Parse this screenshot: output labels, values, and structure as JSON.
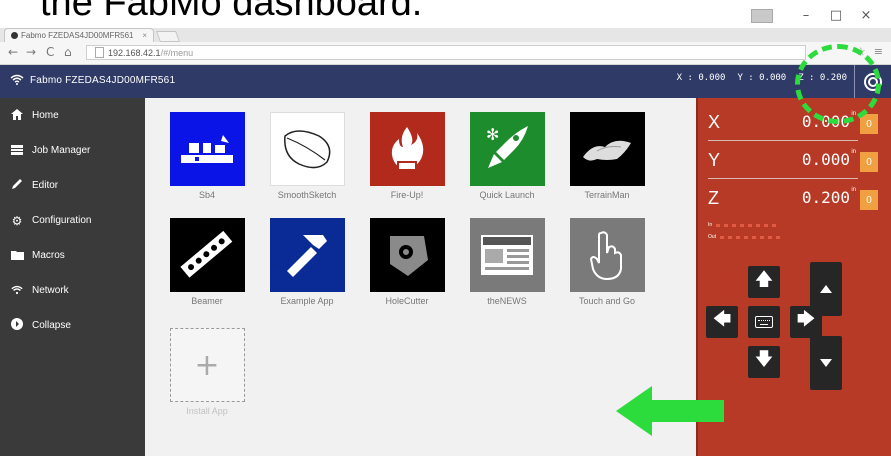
{
  "caption": "the FabMo dashboard.",
  "window": {
    "minimize": "–",
    "maximize": "□",
    "close": "×"
  },
  "browser": {
    "tab_title": "Fabmo FZEDAS4JD00MFR561",
    "tab_close": "×",
    "nav_back": "←",
    "nav_forward": "→",
    "nav_reload": "C",
    "nav_home": "⌂",
    "url_host": "192.168.42.1",
    "url_path": "/#/menu",
    "star": "☆",
    "menu": "≡"
  },
  "topbar": {
    "title": "Fabmo FZEDAS4JD00MFR561",
    "x_readout": "X : 0.000",
    "y_readout": "Y : 0.000",
    "z_readout": "Z : 0.200"
  },
  "sidebar": {
    "items": [
      {
        "label": "Home",
        "icon": "home-icon"
      },
      {
        "label": "Job Manager",
        "icon": "list-icon"
      },
      {
        "label": "Editor",
        "icon": "pencil-icon"
      },
      {
        "label": "Configuration",
        "icon": "gear-icon"
      },
      {
        "label": "Macros",
        "icon": "folder-icon"
      },
      {
        "label": "Network",
        "icon": "wifi-icon"
      },
      {
        "label": "Collapse",
        "icon": "arrow-circle-icon"
      }
    ]
  },
  "apps": [
    {
      "label": "Sb4",
      "color": "#0a14e6"
    },
    {
      "label": "SmoothSketch",
      "color": "#ffffff"
    },
    {
      "label": "Fire-Up!",
      "color": "#b22a1c"
    },
    {
      "label": "Quick Launch",
      "color": "#1c8c2c"
    },
    {
      "label": "TerrainMan",
      "color": "#000000"
    },
    {
      "label": "Beamer",
      "color": "#000000"
    },
    {
      "label": "Example App",
      "color": "#0a2a96"
    },
    {
      "label": "HoleCutter",
      "color": "#000000"
    },
    {
      "label": "theNEWS",
      "color": "#7a7a7a"
    },
    {
      "label": "Touch and Go",
      "color": "#7a7a7a"
    }
  ],
  "add_app": {
    "label": "Install App",
    "glyph": "+"
  },
  "dro": {
    "axes": [
      {
        "name": "X",
        "value": "0.000",
        "unit": "in",
        "zero": "0"
      },
      {
        "name": "Y",
        "value": "0.000",
        "unit": "in",
        "zero": "0"
      },
      {
        "name": "Z",
        "value": "0.200",
        "unit": "in",
        "zero": "0"
      }
    ],
    "in_label": "In",
    "out_label": "Out"
  },
  "annotation_color": "#2cdc3c"
}
